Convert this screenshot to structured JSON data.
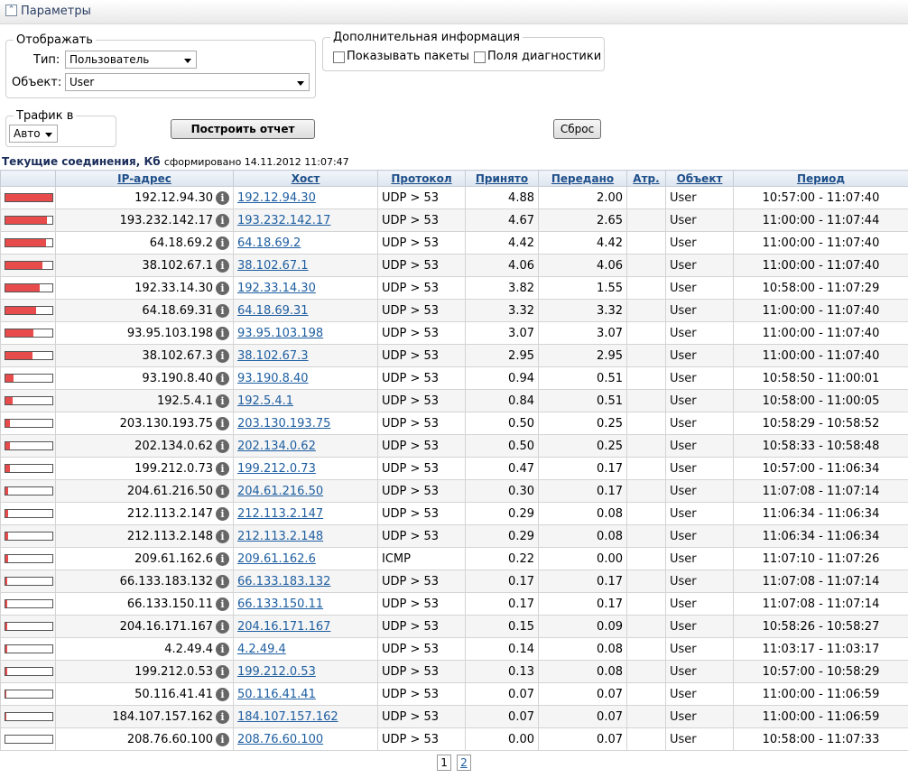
{
  "header": {
    "title": "Параметры"
  },
  "display_group": {
    "legend": "Отображать",
    "type_label": "Тип:",
    "type_value": "Пользователь",
    "object_label": "Объект:",
    "object_value": "User"
  },
  "extra_group": {
    "legend": "Дополнительная информация",
    "show_packets_label": "Показывать пакеты",
    "diag_fields_label": "Поля диагностики"
  },
  "traffic_group": {
    "legend": "Трафик в",
    "value": "Авто"
  },
  "buttons": {
    "build": "Построить отчет",
    "reset": "Сброс"
  },
  "report": {
    "title": "Текущие соединения, Кб",
    "generated": "сформировано 14.11.2012 11:07:47"
  },
  "columns": [
    "IP-адрес",
    "Хост",
    "Протокол",
    "Принято",
    "Передано",
    "Атр.",
    "Объект",
    "Период"
  ],
  "rows": [
    {
      "bar": 1.0,
      "ip": "192.12.94.30",
      "host": "192.12.94.30",
      "proto": "UDP > 53",
      "recv": "4.88",
      "sent": "2.00",
      "attr": "",
      "obj": "User",
      "period": "10:57:00 - 11:07:40"
    },
    {
      "bar": 0.88,
      "ip": "193.232.142.17",
      "host": "193.232.142.17",
      "proto": "UDP > 53",
      "recv": "4.67",
      "sent": "2.65",
      "attr": "",
      "obj": "User",
      "period": "11:00:00 - 11:07:44"
    },
    {
      "bar": 0.86,
      "ip": "64.18.69.2",
      "host": "64.18.69.2",
      "proto": "UDP > 53",
      "recv": "4.42",
      "sent": "4.42",
      "attr": "",
      "obj": "User",
      "period": "11:00:00 - 11:07:40"
    },
    {
      "bar": 0.79,
      "ip": "38.102.67.1",
      "host": "38.102.67.1",
      "proto": "UDP > 53",
      "recv": "4.06",
      "sent": "4.06",
      "attr": "",
      "obj": "User",
      "period": "11:00:00 - 11:07:40"
    },
    {
      "bar": 0.74,
      "ip": "192.33.14.30",
      "host": "192.33.14.30",
      "proto": "UDP > 53",
      "recv": "3.82",
      "sent": "1.55",
      "attr": "",
      "obj": "User",
      "period": "10:58:00 - 11:07:29"
    },
    {
      "bar": 0.65,
      "ip": "64.18.69.31",
      "host": "64.18.69.31",
      "proto": "UDP > 53",
      "recv": "3.32",
      "sent": "3.32",
      "attr": "",
      "obj": "User",
      "period": "11:00:00 - 11:07:40"
    },
    {
      "bar": 0.6,
      "ip": "93.95.103.198",
      "host": "93.95.103.198",
      "proto": "UDP > 53",
      "recv": "3.07",
      "sent": "3.07",
      "attr": "",
      "obj": "User",
      "period": "11:00:00 - 11:07:40"
    },
    {
      "bar": 0.57,
      "ip": "38.102.67.3",
      "host": "38.102.67.3",
      "proto": "UDP > 53",
      "recv": "2.95",
      "sent": "2.95",
      "attr": "",
      "obj": "User",
      "period": "11:00:00 - 11:07:40"
    },
    {
      "bar": 0.18,
      "ip": "93.190.8.40",
      "host": "93.190.8.40",
      "proto": "UDP > 53",
      "recv": "0.94",
      "sent": "0.51",
      "attr": "",
      "obj": "User",
      "period": "10:58:50 - 11:00:01"
    },
    {
      "bar": 0.16,
      "ip": "192.5.4.1",
      "host": "192.5.4.1",
      "proto": "UDP > 53",
      "recv": "0.84",
      "sent": "0.51",
      "attr": "",
      "obj": "User",
      "period": "10:58:00 - 11:00:05"
    },
    {
      "bar": 0.1,
      "ip": "203.130.193.75",
      "host": "203.130.193.75",
      "proto": "UDP > 53",
      "recv": "0.50",
      "sent": "0.25",
      "attr": "",
      "obj": "User",
      "period": "10:58:29 - 10:58:52"
    },
    {
      "bar": 0.1,
      "ip": "202.134.0.62",
      "host": "202.134.0.62",
      "proto": "UDP > 53",
      "recv": "0.50",
      "sent": "0.25",
      "attr": "",
      "obj": "User",
      "period": "10:58:33 - 10:58:48"
    },
    {
      "bar": 0.09,
      "ip": "199.212.0.73",
      "host": "199.212.0.73",
      "proto": "UDP > 53",
      "recv": "0.47",
      "sent": "0.17",
      "attr": "",
      "obj": "User",
      "period": "10:57:00 - 11:06:34"
    },
    {
      "bar": 0.06,
      "ip": "204.61.216.50",
      "host": "204.61.216.50",
      "proto": "UDP > 53",
      "recv": "0.30",
      "sent": "0.17",
      "attr": "",
      "obj": "User",
      "period": "11:07:08 - 11:07:14"
    },
    {
      "bar": 0.06,
      "ip": "212.113.2.147",
      "host": "212.113.2.147",
      "proto": "UDP > 53",
      "recv": "0.29",
      "sent": "0.08",
      "attr": "",
      "obj": "User",
      "period": "11:06:34 - 11:06:34"
    },
    {
      "bar": 0.06,
      "ip": "212.113.2.148",
      "host": "212.113.2.148",
      "proto": "UDP > 53",
      "recv": "0.29",
      "sent": "0.08",
      "attr": "",
      "obj": "User",
      "period": "11:06:34 - 11:06:34"
    },
    {
      "bar": 0.05,
      "ip": "209.61.162.6",
      "host": "209.61.162.6",
      "proto": "ICMP",
      "recv": "0.22",
      "sent": "0.00",
      "attr": "",
      "obj": "User",
      "period": "11:07:10 - 11:07:26"
    },
    {
      "bar": 0.04,
      "ip": "66.133.183.132",
      "host": "66.133.183.132",
      "proto": "UDP > 53",
      "recv": "0.17",
      "sent": "0.17",
      "attr": "",
      "obj": "User",
      "period": "11:07:08 - 11:07:14"
    },
    {
      "bar": 0.04,
      "ip": "66.133.150.11",
      "host": "66.133.150.11",
      "proto": "UDP > 53",
      "recv": "0.17",
      "sent": "0.17",
      "attr": "",
      "obj": "User",
      "period": "11:07:08 - 11:07:14"
    },
    {
      "bar": 0.03,
      "ip": "204.16.171.167",
      "host": "204.16.171.167",
      "proto": "UDP > 53",
      "recv": "0.15",
      "sent": "0.09",
      "attr": "",
      "obj": "User",
      "period": "10:58:26 - 10:58:27"
    },
    {
      "bar": 0.03,
      "ip": "4.2.49.4",
      "host": "4.2.49.4",
      "proto": "UDP > 53",
      "recv": "0.14",
      "sent": "0.08",
      "attr": "",
      "obj": "User",
      "period": "11:03:17 - 11:03:17"
    },
    {
      "bar": 0.03,
      "ip": "199.212.0.53",
      "host": "199.212.0.53",
      "proto": "UDP > 53",
      "recv": "0.13",
      "sent": "0.08",
      "attr": "",
      "obj": "User",
      "period": "10:57:00 - 10:58:29"
    },
    {
      "bar": 0.01,
      "ip": "50.116.41.41",
      "host": "50.116.41.41",
      "proto": "UDP > 53",
      "recv": "0.07",
      "sent": "0.07",
      "attr": "",
      "obj": "User",
      "period": "11:00:00 - 11:06:59"
    },
    {
      "bar": 0.01,
      "ip": "184.107.157.162",
      "host": "184.107.157.162",
      "proto": "UDP > 53",
      "recv": "0.07",
      "sent": "0.07",
      "attr": "",
      "obj": "User",
      "period": "11:00:00 - 11:06:59"
    },
    {
      "bar": 0.0,
      "ip": "208.76.60.100",
      "host": "208.76.60.100",
      "proto": "UDP > 53",
      "recv": "0.00",
      "sent": "0.07",
      "attr": "",
      "obj": "User",
      "period": "10:58:00 - 11:07:33"
    }
  ],
  "pager": {
    "current": "1",
    "next": "2"
  },
  "icons": {
    "info": "info-icon",
    "collapse": "collapse-icon"
  },
  "colors": {
    "bar_fill": "#e84b4b",
    "link": "#1e5ea0",
    "header_text": "#1e4f8a"
  }
}
